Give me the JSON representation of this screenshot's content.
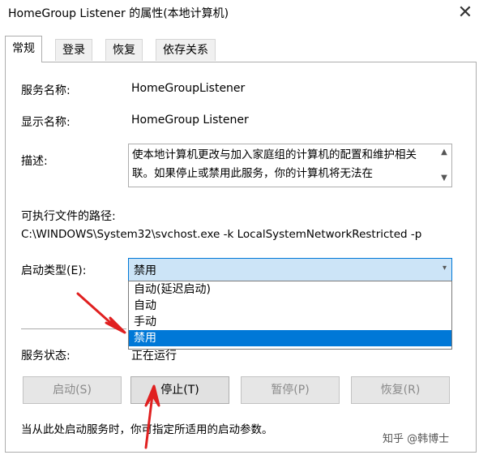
{
  "window": {
    "title": "HomeGroup Listener 的属性(本地计算机)",
    "close_glyph": "✕"
  },
  "tabs": [
    {
      "label": "常规"
    },
    {
      "label": "登录"
    },
    {
      "label": "恢复"
    },
    {
      "label": "依存关系"
    }
  ],
  "general": {
    "service_name_label": "服务名称:",
    "service_name": "HomeGroupListener",
    "display_name_label": "显示名称:",
    "display_name": "HomeGroup Listener",
    "description_label": "描述:",
    "description": "使本地计算机更改与加入家庭组的计算机的配置和维护相关联。如果停止或禁用此服务，你的计算机将无法在",
    "exe_path_label": "可执行文件的路径:",
    "exe_path": "C:\\WINDOWS\\System32\\svchost.exe -k LocalSystemNetworkRestricted -p",
    "startup_type_label": "启动类型(E):",
    "startup_type_selected": "禁用",
    "startup_options": [
      "自动(延迟启动)",
      "自动",
      "手动",
      "禁用"
    ],
    "service_status_label": "服务状态:",
    "service_status": "正在运行",
    "note": "当从此处启动服务时，你可指定所适用的启动参数。"
  },
  "buttons": {
    "start": "启动(S)",
    "stop": "停止(T)",
    "pause": "暂停(P)",
    "resume": "恢复(R)"
  },
  "watermark": "知乎 @韩博士",
  "colors": {
    "accent": "#0078d7",
    "arrow": "#e02020"
  }
}
